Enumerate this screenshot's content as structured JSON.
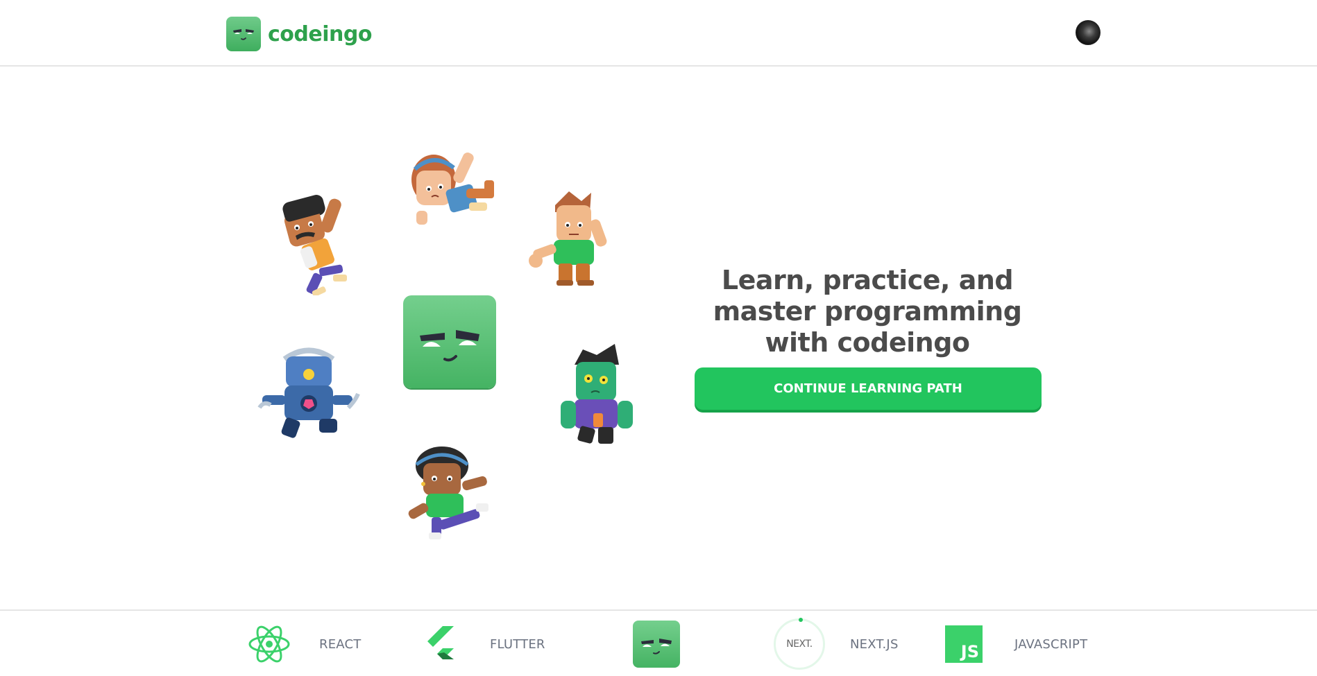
{
  "header": {
    "brand": "codeingo",
    "brand_icon": "codeingo-mascot-icon",
    "avatar_icon": "user-avatar-icon"
  },
  "hero": {
    "headline": "Learn, practice, and master programming with codeingo",
    "cta_label": "CONTINUE LEARNING PATH",
    "characters": [
      "character-mustache-man",
      "character-girl-headband",
      "character-boy-green-shirt",
      "character-robot",
      "character-zombie",
      "character-girl-green-shirt"
    ]
  },
  "footer": {
    "courses": [
      {
        "label": "REACT",
        "icon": "react-icon"
      },
      {
        "label": "FLUTTER",
        "icon": "flutter-icon"
      },
      {
        "label": "",
        "icon": "codeingo-mascot-icon"
      },
      {
        "label": "NEXT.JS",
        "icon": "nextjs-icon",
        "icon_text": "NEXT."
      },
      {
        "label": "JAVASCRIPT",
        "icon": "javascript-icon",
        "icon_text": "JS"
      }
    ]
  },
  "colors": {
    "brand_green": "#2ea14c",
    "cta_green": "#22c55e",
    "cta_shadow": "#16a34a",
    "text_dark": "#4b4b4b",
    "text_muted": "#6b7280",
    "divider": "#e5e5e5"
  }
}
